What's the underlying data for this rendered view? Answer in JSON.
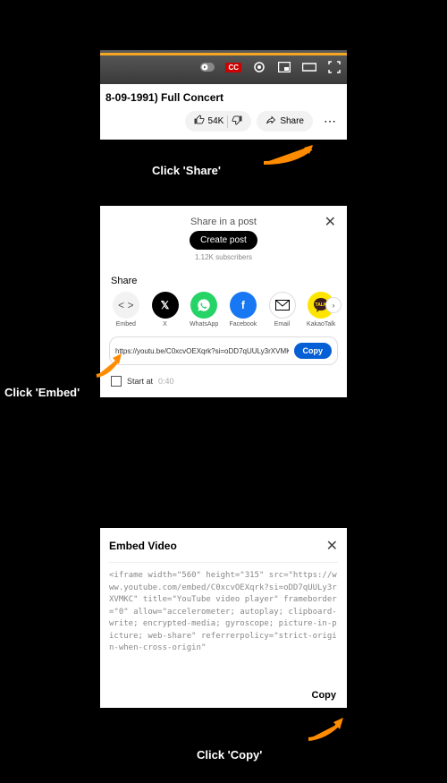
{
  "panel1": {
    "title": "8-09-1991) Full Concert",
    "likes": "54K",
    "share": "Share"
  },
  "caption1": "Click 'Share'",
  "panel2": {
    "header": "Share in a post",
    "create_post": "Create post",
    "subscribers": "1.12K subscribers",
    "share_label": "Share",
    "items": {
      "embed": "Embed",
      "x": "X",
      "whatsapp": "WhatsApp",
      "facebook": "Facebook",
      "email": "Email",
      "kakao": "KakaoTalk"
    },
    "url": "https://youtu.be/C0xcvOEXqrk?si=oDD7qUULy3rXVMK",
    "copy": "Copy",
    "start_at": "Start at",
    "start_time": "0:40"
  },
  "caption2": "Click 'Embed'",
  "panel3": {
    "title": "Embed Video",
    "code": "<iframe width=\"560\" height=\"315\" src=\"https://www.youtube.com/embed/C0xcvOEXqrk?si=oDD7qUULy3rXVMKC\" title=\"YouTube video player\" frameborder=\"0\" allow=\"accelerometer; autoplay; clipboard-write; encrypted-media; gyroscope; picture-in-picture; web-share\" referrerpolicy=\"strict-origin-when-cross-origin\"",
    "copy": "Copy"
  },
  "caption3": "Click 'Copy'"
}
